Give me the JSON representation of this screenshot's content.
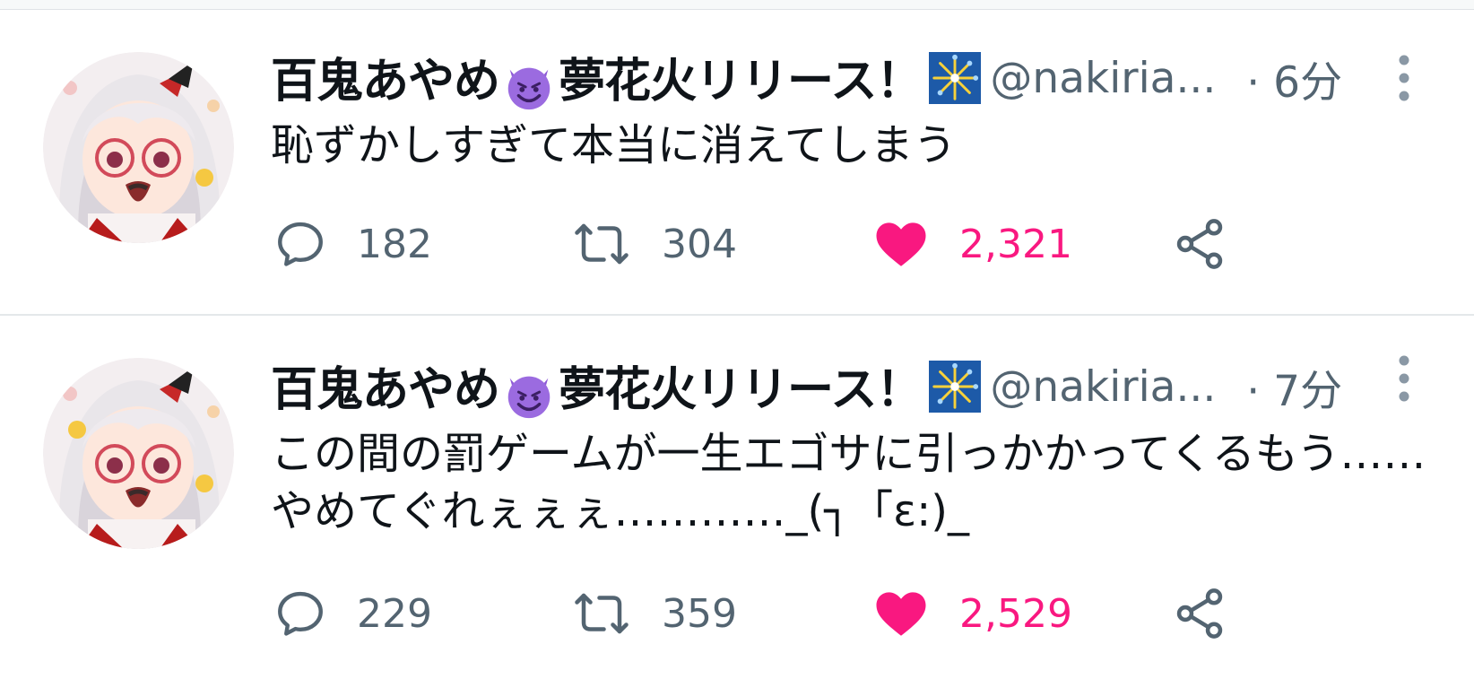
{
  "colors": {
    "text": "#0f1419",
    "secondary": "#536471",
    "like": "#f91880",
    "divider": "#e4e8ea"
  },
  "tweets": [
    {
      "name_part1": "百鬼あやめ",
      "name_part2": "夢花火リリース！",
      "name_emoji_icon": "smiling-devil-emoji-icon",
      "badge_icon": "firework-emoji-icon",
      "handle": "@nakiria...",
      "time": "· 6分",
      "text": "恥ずかしすぎて本当に消えてしまう",
      "reply_count": "182",
      "retweet_count": "304",
      "like_count": "2,321",
      "liked": true
    },
    {
      "name_part1": "百鬼あやめ",
      "name_part2": "夢花火リリース！",
      "name_emoji_icon": "smiling-devil-emoji-icon",
      "badge_icon": "firework-emoji-icon",
      "handle": "@nakiria...",
      "time": "· 7分",
      "text": "この間の罰ゲームが一生エゴサに引っかかってくるもう……やめてぐれぇぇぇ…………_(┐「ε:)_",
      "reply_count": "229",
      "retweet_count": "359",
      "like_count": "2,529",
      "liked": true
    }
  ]
}
